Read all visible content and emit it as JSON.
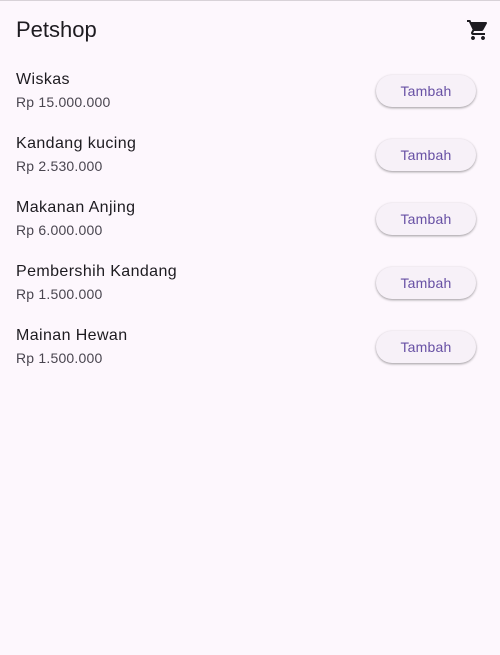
{
  "app_bar": {
    "title": "Petshop",
    "cart_icon": "shopping-cart-icon"
  },
  "products": [
    {
      "name": "Wiskas",
      "price": "Rp 15.000.000",
      "button_label": "Tambah"
    },
    {
      "name": "Kandang kucing",
      "price": "Rp 2.530.000",
      "button_label": "Tambah"
    },
    {
      "name": "Makanan Anjing",
      "price": "Rp 6.000.000",
      "button_label": "Tambah"
    },
    {
      "name": "Pembershih Kandang",
      "price": "Rp 1.500.000",
      "button_label": "Tambah"
    },
    {
      "name": "Mainan Hewan",
      "price": "Rp 1.500.000",
      "button_label": "Tambah"
    }
  ],
  "colors": {
    "background": "#fdf7fd",
    "accent": "#6750a4",
    "button_background": "#f7f1f8",
    "text_primary": "#1d1b20",
    "text_secondary": "#49454f"
  }
}
